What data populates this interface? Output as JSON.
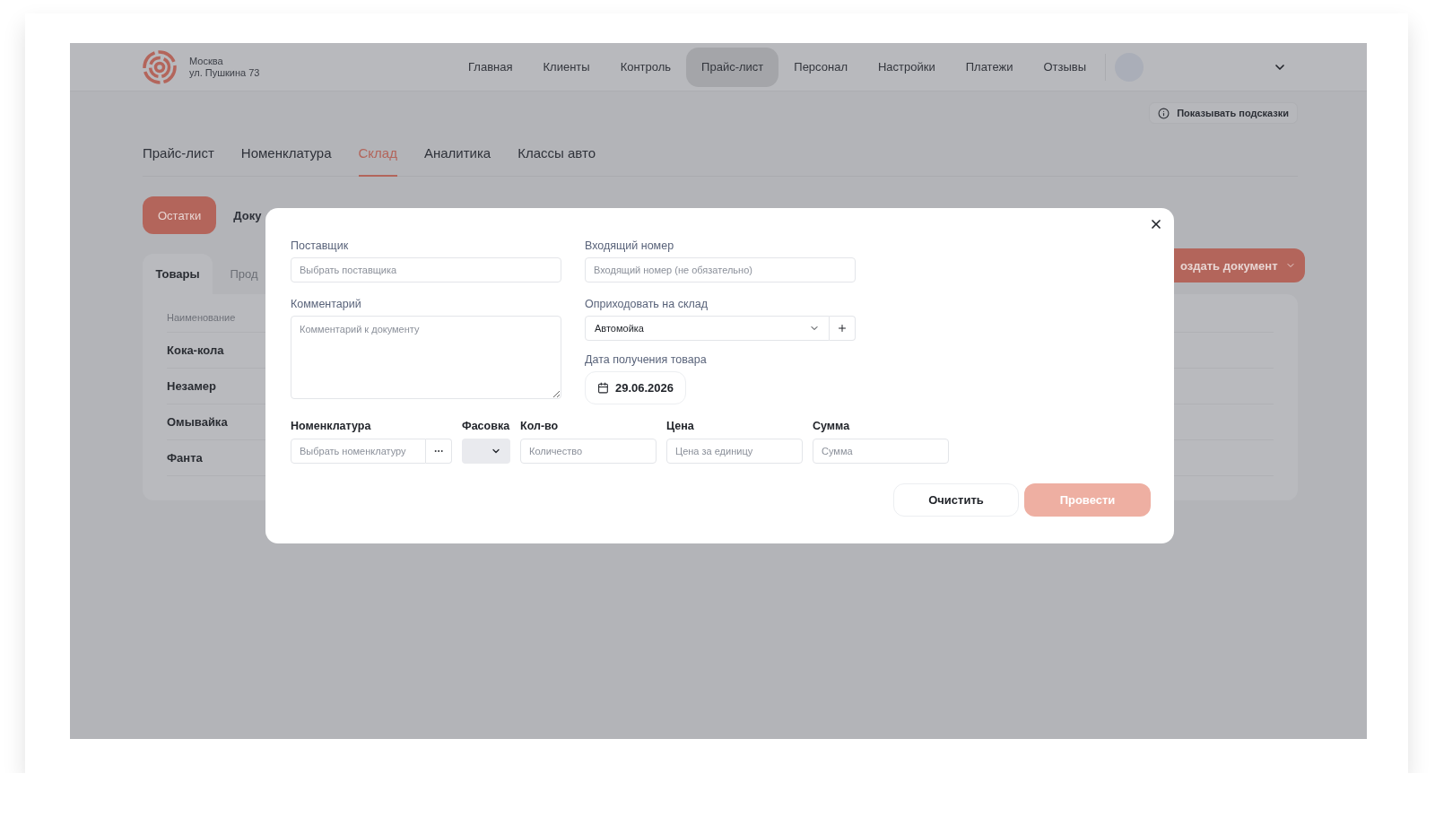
{
  "header": {
    "city": "Москва",
    "address": "ул. Пушкина 73",
    "nav": [
      {
        "label": "Главная",
        "selected": false
      },
      {
        "label": "Клиенты",
        "selected": false
      },
      {
        "label": "Контроль",
        "selected": false
      },
      {
        "label": "Прайс-лист",
        "selected": true
      },
      {
        "label": "Персонал",
        "selected": false
      },
      {
        "label": "Настройки",
        "selected": false
      },
      {
        "label": "Платежи",
        "selected": false
      },
      {
        "label": "Отзывы",
        "selected": false
      }
    ]
  },
  "hints_button": "Показывать подсказки",
  "section_tabs": [
    {
      "label": "Прайс-лист",
      "selected": false
    },
    {
      "label": "Номенклатура",
      "selected": false
    },
    {
      "label": "Склад",
      "selected": true
    },
    {
      "label": "Аналитика",
      "selected": false
    },
    {
      "label": "Классы авто",
      "selected": false
    }
  ],
  "view_tabs": [
    {
      "label": "Остатки",
      "selected": true
    },
    {
      "label": "Доку",
      "selected": false
    }
  ],
  "create_button": "оздать документ",
  "panel": {
    "tabs": [
      {
        "label": "Товары",
        "selected": true
      },
      {
        "label": "Прод",
        "selected": false
      }
    ],
    "column": "Наименование",
    "rows": [
      "Кока-кола",
      "Незамер",
      "Омывайка",
      "Фанта"
    ]
  },
  "modal": {
    "supplier": {
      "label": "Поставщик",
      "placeholder": "Выбрать поставщика"
    },
    "incoming_number": {
      "label": "Входящий номер",
      "placeholder": "Входящий номер (не обязательно)"
    },
    "comment": {
      "label": "Комментарий",
      "placeholder": "Комментарий к документу"
    },
    "warehouse": {
      "label": "Оприходовать на склад",
      "value": "Автомойка"
    },
    "date": {
      "label": "Дата получения товара",
      "value": "29.06.2026"
    },
    "nomenclature": {
      "label": "Номенклатура",
      "placeholder": "Выбрать номенклатуру"
    },
    "packaging": {
      "label": "Фасовка"
    },
    "quantity": {
      "label": "Кол-во",
      "placeholder": "Количество"
    },
    "price": {
      "label": "Цена",
      "placeholder": "Цена за единицу"
    },
    "sum": {
      "label": "Сумма",
      "placeholder": "Сумма"
    },
    "clear_button": "Очистить",
    "submit_button": {
      "label": "Провести",
      "disabled": true
    }
  }
}
